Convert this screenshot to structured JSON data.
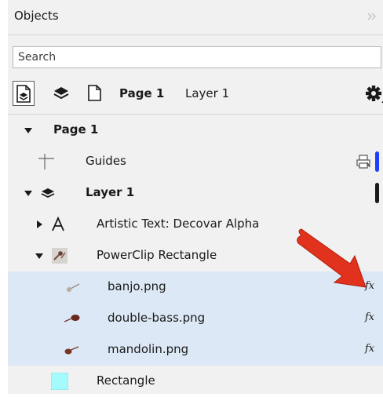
{
  "panel": {
    "title": "Objects",
    "collapse_icon": "double-chevron-right-icon"
  },
  "search": {
    "placeholder": "Search",
    "value": ""
  },
  "toolbar": {
    "page_label": "Page 1",
    "layer_label": "Layer 1",
    "icons": [
      "show-object-properties-icon",
      "layers-icon",
      "page-icon",
      "gear-icon"
    ]
  },
  "tree": {
    "page": {
      "label": "Page 1",
      "expanded": true
    },
    "guides": {
      "label": "Guides"
    },
    "layer": {
      "label": "Layer 1",
      "expanded": true
    },
    "artistic_text": {
      "label": "Artistic Text: Decovar Alpha",
      "expanded": false
    },
    "powerclip": {
      "label": "PowerClip Rectangle",
      "expanded": true
    },
    "children": [
      {
        "label": "banjo.png",
        "effect": "fx"
      },
      {
        "label": "double-bass.png",
        "effect": "fx"
      },
      {
        "label": "mandolin.png",
        "effect": "fx"
      }
    ],
    "rectangle": {
      "label": "Rectangle",
      "color": "#a5fbfb"
    }
  },
  "colors": {
    "selection": "#dce8f5",
    "guides_layer": "#1f3fff",
    "layer_color": "#1a1a1a",
    "arrow": "#e0321c"
  }
}
